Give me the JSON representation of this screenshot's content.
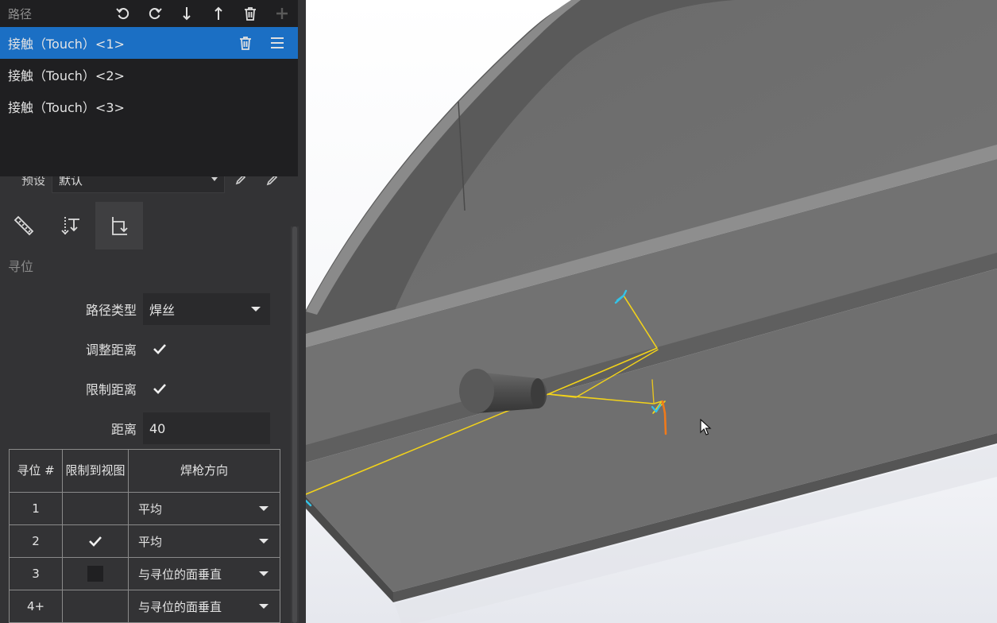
{
  "path_list": {
    "title": "路径",
    "toolbar_icons": [
      "undo-icon",
      "redo-icon",
      "move-down-icon",
      "move-up-icon",
      "trash-icon",
      "plus-icon"
    ],
    "items": [
      {
        "label": "接触（Touch）<1>",
        "selected": true
      },
      {
        "label": "接触（Touch）<2>",
        "selected": false
      },
      {
        "label": "接触（Touch）<3>",
        "selected": false
      }
    ]
  },
  "preset": {
    "label": "预设",
    "value": "默认"
  },
  "mode_tabs": [
    {
      "icon": "weld-line-icon",
      "active": false
    },
    {
      "icon": "clearance-icon",
      "active": false
    },
    {
      "icon": "touch-sense-icon",
      "active": true
    }
  ],
  "section": {
    "label": "寻位"
  },
  "form": {
    "path_type": {
      "label": "路径类型",
      "value": "焊丝"
    },
    "adjust_distance": {
      "label": "调整距离",
      "checked": true
    },
    "limit_distance": {
      "label": "限制距离",
      "checked": true
    },
    "distance": {
      "label": "距离",
      "value": "40"
    }
  },
  "table": {
    "headers": {
      "num": "寻位 #",
      "limit": "限制到视图",
      "direction": "焊枪方向"
    },
    "rows": [
      {
        "num": "1",
        "limit": "none",
        "direction": "平均"
      },
      {
        "num": "2",
        "limit": "checked",
        "direction": "平均"
      },
      {
        "num": "3",
        "limit": "unchecked",
        "direction": "与寻位的面垂直"
      },
      {
        "num": "4+",
        "limit": "none",
        "direction": "与寻位的面垂直"
      }
    ]
  },
  "colors": {
    "selection": "#1b6fc4",
    "panel": "#333335",
    "path_list_bg": "#1f1f21",
    "touch_path": "#f2d21a",
    "touch_tip_cyan": "#33c3e8",
    "touch_tip_orange": "#f07a1a"
  }
}
